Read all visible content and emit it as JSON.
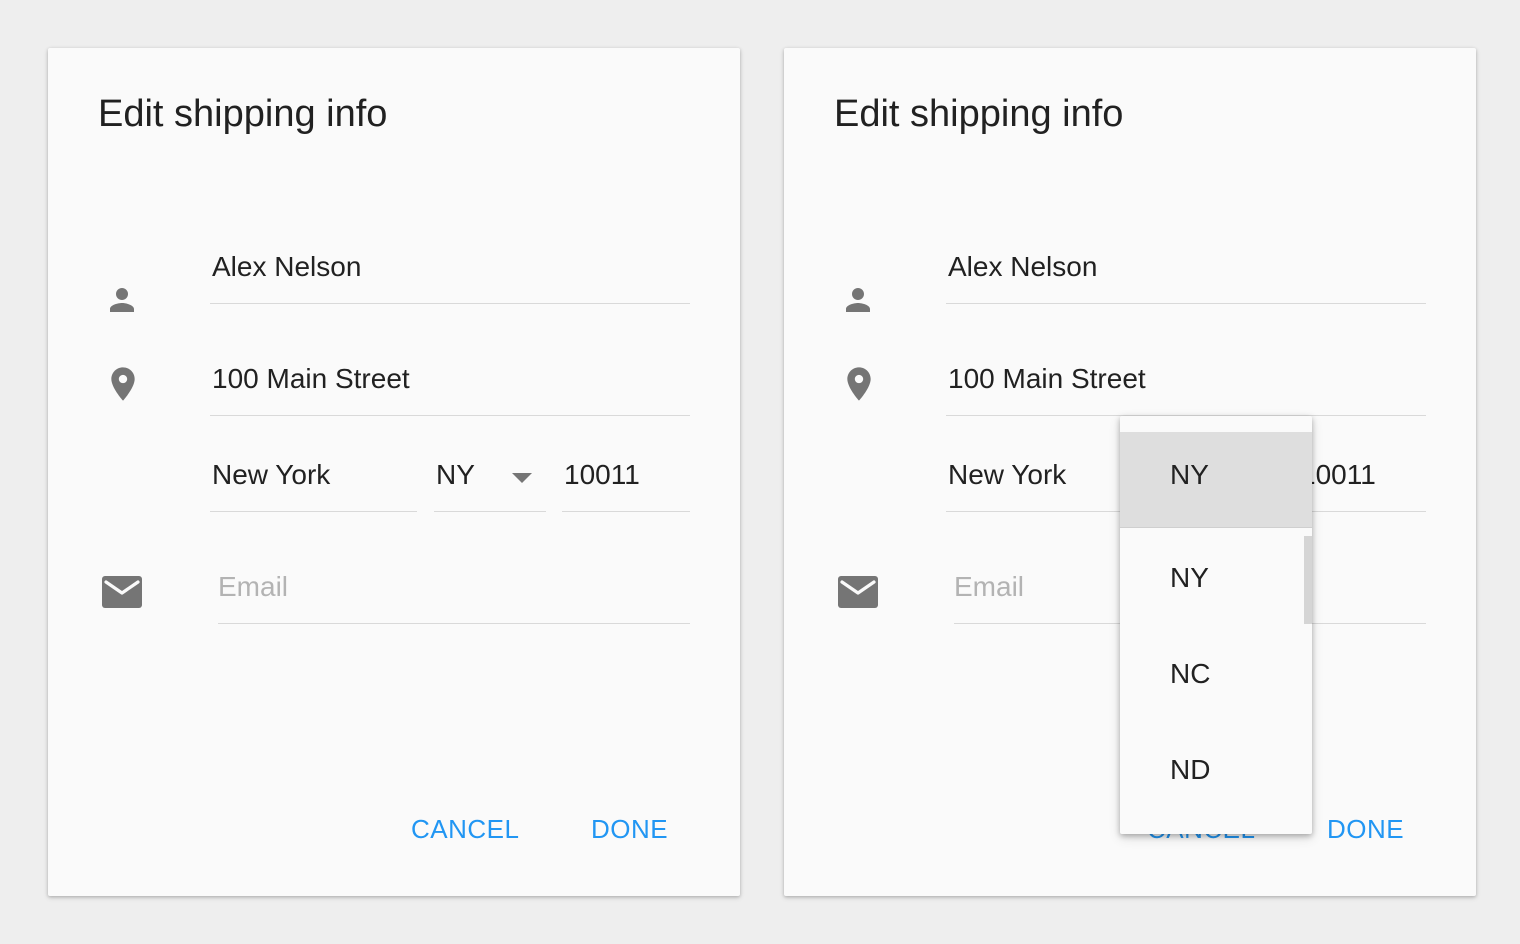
{
  "colors": {
    "background": "#eeeeee",
    "dialog": "#fafafa",
    "accent": "#2196f3",
    "icon": "#757575",
    "placeholder": "#b3b3b3",
    "selected_item": "#dedede"
  },
  "dialogs": [
    {
      "title": "Edit shipping info",
      "name": "Alex Nelson",
      "street": "100 Main Street",
      "city": "New York",
      "state": "NY",
      "zip": "10011",
      "email_placeholder": "Email",
      "cancel_label": "CANCEL",
      "done_label": "DONE",
      "icons": {
        "name": "person-icon",
        "address": "location-pin-icon",
        "email": "mail-icon",
        "state_dropdown": "caret-down-icon"
      }
    },
    {
      "title": "Edit shipping info",
      "name": "Alex Nelson",
      "street": "100 Main Street",
      "city": "New York",
      "zip": "10011",
      "email_placeholder": "Email",
      "cancel_label": "CANCEL",
      "done_label": "DONE",
      "icons": {
        "name": "person-icon",
        "address": "location-pin-icon",
        "email": "mail-icon"
      }
    }
  ],
  "state_dropdown": {
    "selected": "NY",
    "options": [
      "NY",
      "NC",
      "ND"
    ]
  }
}
